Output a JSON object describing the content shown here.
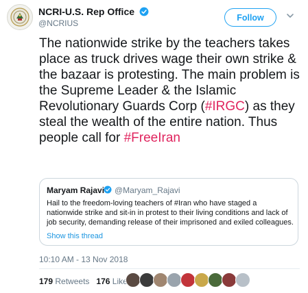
{
  "account": {
    "display_name": "NCRI-U.S. Rep Office",
    "handle": "@NCRIUS",
    "verified": true,
    "avatar_icon": "seal-emblem"
  },
  "header": {
    "follow_label": "Follow",
    "menu_icon": "chevron-down-icon"
  },
  "tweet": {
    "segments": [
      "The nationwide strike by the teachers takes place as truck drives wage their own strike & the bazaar is protesting. The main problem is the Supreme Leader & the Islamic Revolutionary Guards Corp (",
      "#IRGC",
      ") as they steal the wealth of the entire nation. Thus people call for ",
      "#FreeIran"
    ],
    "hashtag_color": "#e0245e"
  },
  "quoted_tweet": {
    "name": "Maryam Rajavi",
    "handle": "@Maryam_Rajavi",
    "verified": true,
    "text": "Hail to the freedom-loving teachers of #Iran who have staged a nationwide strike and sit-in in protest to their living conditions and lack of job security, demanding release of their imprisoned and exiled colleagues.",
    "show_thread_label": "Show this thread"
  },
  "timestamp": "10:10 AM - 13 Nov 2018",
  "stats": {
    "retweets_count": "179",
    "retweets_label": "Retweets",
    "likes_count": "176",
    "likes_label": "Likes"
  },
  "colors": {
    "accent": "#1da1f2",
    "text": "#14171a",
    "muted": "#657786",
    "border": "#ccd6dd"
  }
}
